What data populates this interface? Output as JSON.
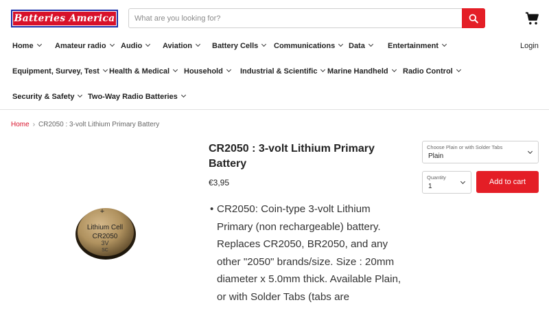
{
  "header": {
    "logo_text": "Batteries America",
    "search_placeholder": "What are you looking for?",
    "login": "Login"
  },
  "nav": {
    "row1": [
      "Home",
      "Amateur radio",
      "Audio",
      "Aviation",
      "Battery Cells",
      "Communications",
      "Data",
      "Entertainment"
    ],
    "row2": [
      "Equipment, Survey, Test",
      "Health & Medical",
      "Household",
      "Industrial & Scientific",
      "Marine Handheld",
      "Radio Control"
    ],
    "row3": [
      "Security & Safety",
      "Two-Way Radio Batteries"
    ]
  },
  "breadcrumb": {
    "home": "Home",
    "separator": "›",
    "current": "CR2050 : 3-volt Lithium Primary Battery"
  },
  "product": {
    "title": "CR2050 : 3-volt Lithium Primary Battery",
    "price": "€3,95",
    "description": "CR2050: Coin-type 3-volt Lithium Primary (non rechargeable) battery. Replaces CR2050, BR2050, and any other \"2050\" brands/size. Size : 20mm diameter x 5.0mm thick. Available Plain, or with Solder Tabs (tabs are",
    "image_text": {
      "line1": "Lithium Cell",
      "line2": "CR2050",
      "line3": "3V",
      "line4": "SC"
    }
  },
  "purchase": {
    "variant_label": "Choose Plain or with Solder Tabs",
    "variant_value": "Plain",
    "quantity_label": "Quantity",
    "quantity_value": "1",
    "add_to_cart": "Add to cart"
  },
  "colors": {
    "brand_red": "#e41e26",
    "logo_blue": "#1a2fa8"
  }
}
